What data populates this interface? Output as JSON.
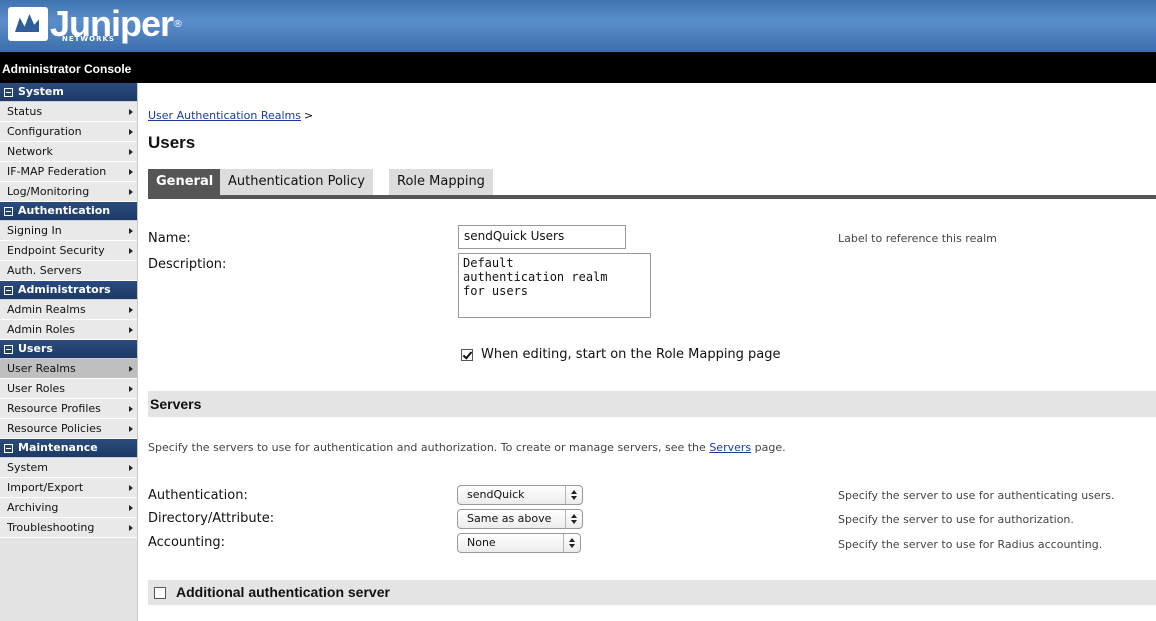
{
  "brand": {
    "name": "Juniper",
    "sub": "NETWORKS",
    "reg": "®"
  },
  "console_title": "Administrator Console",
  "sidebar": [
    {
      "section": "System",
      "items": [
        {
          "label": "Status",
          "arrow": true
        },
        {
          "label": "Configuration",
          "arrow": true
        },
        {
          "label": "Network",
          "arrow": true
        },
        {
          "label": "IF-MAP Federation",
          "arrow": true
        },
        {
          "label": "Log/Monitoring",
          "arrow": true
        }
      ]
    },
    {
      "section": "Authentication",
      "items": [
        {
          "label": "Signing In",
          "arrow": true
        },
        {
          "label": "Endpoint Security",
          "arrow": true
        },
        {
          "label": "Auth. Servers",
          "arrow": false
        }
      ]
    },
    {
      "section": "Administrators",
      "items": [
        {
          "label": "Admin Realms",
          "arrow": true
        },
        {
          "label": "Admin Roles",
          "arrow": true
        }
      ]
    },
    {
      "section": "Users",
      "items": [
        {
          "label": "User Realms",
          "arrow": true,
          "active": true
        },
        {
          "label": "User Roles",
          "arrow": true
        },
        {
          "label": "Resource Profiles",
          "arrow": true
        },
        {
          "label": "Resource Policies",
          "arrow": true
        }
      ]
    },
    {
      "section": "Maintenance",
      "items": [
        {
          "label": "System",
          "arrow": true
        },
        {
          "label": "Import/Export",
          "arrow": true
        },
        {
          "label": "Archiving",
          "arrow": true
        },
        {
          "label": "Troubleshooting",
          "arrow": true
        }
      ]
    }
  ],
  "breadcrumb": {
    "link": "User Authentication Realms",
    "sep": ">"
  },
  "page_title": "Users",
  "tabs": [
    {
      "label": "General",
      "selected": true
    },
    {
      "label": "Authentication Policy",
      "selected": false
    },
    {
      "label": "Role Mapping",
      "selected": false
    }
  ],
  "general": {
    "name_label": "Name:",
    "name_value": "sendQuick Users",
    "name_hint": "Label to reference this realm",
    "desc_label": "Description:",
    "desc_value": "Default\nauthentication realm\nfor users",
    "role_mapping_check": "When editing, start on the Role Mapping page",
    "role_mapping_checked": true
  },
  "servers": {
    "title": "Servers",
    "intro_before": "Specify the servers to use for authentication and authorization. To create or manage servers, see the",
    "intro_link": "Servers",
    "intro_after": "page.",
    "auth_label": "Authentication:",
    "auth_value": "sendQuick",
    "auth_hint": "Specify the server to use for authenticating users.",
    "dir_label": "Directory/Attribute:",
    "dir_value": "Same as above",
    "dir_hint": "Specify the server to use for authorization.",
    "acct_label": "Accounting:",
    "acct_value": "None",
    "acct_hint": "Specify the server to use for Radius accounting."
  },
  "additional": {
    "label": "Additional authentication server",
    "checked": false
  }
}
